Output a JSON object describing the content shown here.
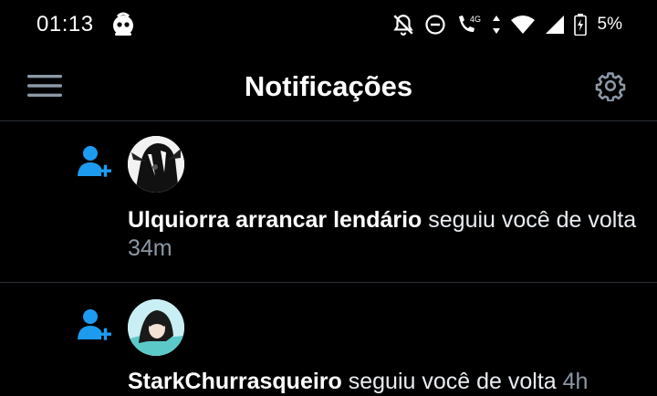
{
  "status_bar": {
    "time": "01:13",
    "network": "4G",
    "battery": "5%",
    "icons": [
      "app-notification-icon",
      "notifications-off-icon",
      "do-not-disturb-icon",
      "wifi-calling-icon",
      "wifi-icon",
      "signal-icon",
      "battery-charging-icon"
    ]
  },
  "header": {
    "title": "Notificações",
    "menu_icon": "hamburger-menu-icon",
    "settings_icon": "gear-icon"
  },
  "notifications": [
    {
      "type_icon": "person-add-icon",
      "username": "Ulquiorra arrancar lendário",
      "action": " seguiu você de volta ",
      "time": "34m"
    },
    {
      "type_icon": "person-add-icon",
      "username": "StarkChurrasqueiro",
      "action": " seguiu você de volta ",
      "time": "4h"
    }
  ],
  "colors": {
    "background": "#000000",
    "accent": "#1d9bf0",
    "divider": "#2a2f36",
    "secondary_text": "#8b98a5"
  }
}
